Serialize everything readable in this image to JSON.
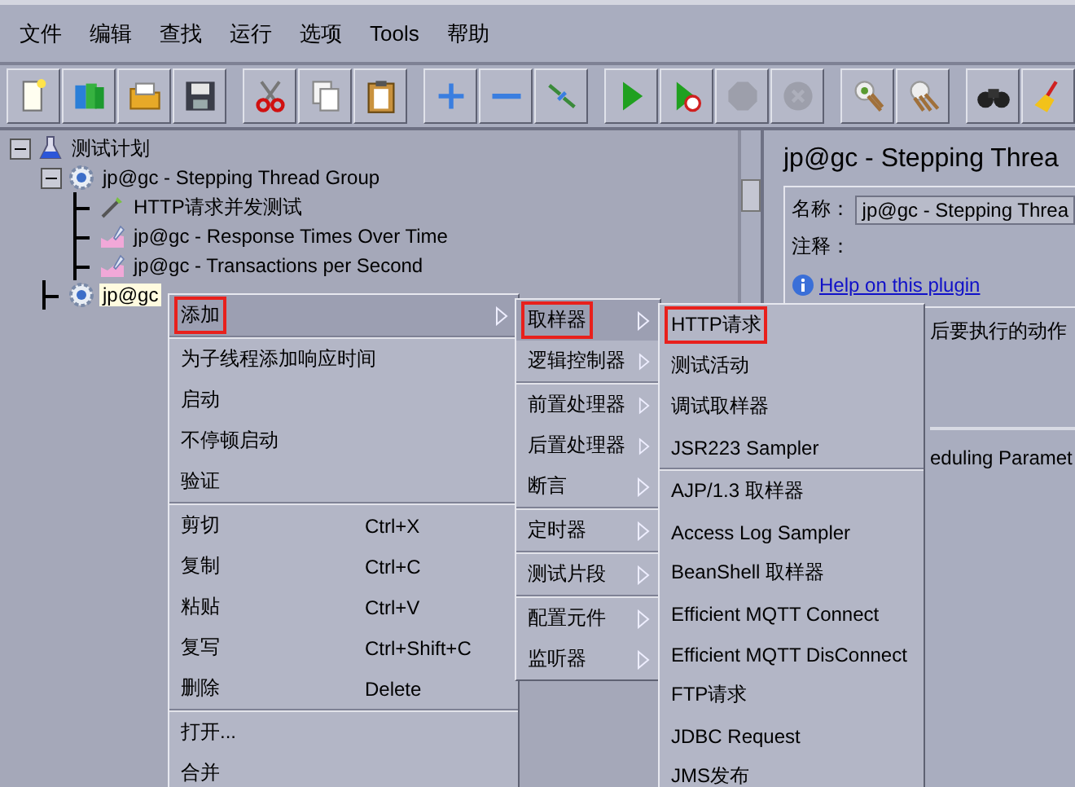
{
  "menu_bar": [
    {
      "label": "文件"
    },
    {
      "label": "编辑"
    },
    {
      "label": "查找"
    },
    {
      "label": "运行"
    },
    {
      "label": "选项"
    },
    {
      "label": "Tools"
    },
    {
      "label": "帮助"
    }
  ],
  "toolbar": [
    [
      {
        "kind": "new",
        "disabled": false
      },
      {
        "kind": "templates",
        "disabled": false
      },
      {
        "kind": "open",
        "disabled": false
      },
      {
        "kind": "save",
        "disabled": false
      }
    ],
    [
      {
        "kind": "cut",
        "disabled": false
      },
      {
        "kind": "copy",
        "disabled": false
      },
      {
        "kind": "paste",
        "disabled": false
      }
    ],
    [
      {
        "kind": "expand",
        "disabled": false
      },
      {
        "kind": "collapse",
        "disabled": false
      },
      {
        "kind": "toggle",
        "disabled": false
      }
    ],
    [
      {
        "kind": "start",
        "disabled": false
      },
      {
        "kind": "start_no_pause",
        "disabled": false
      },
      {
        "kind": "stop",
        "disabled": true
      },
      {
        "kind": "shutdown",
        "disabled": true
      }
    ],
    [
      {
        "kind": "clear",
        "disabled": false
      },
      {
        "kind": "clear_all",
        "disabled": false
      }
    ],
    [
      {
        "kind": "search",
        "disabled": false
      },
      {
        "kind": "reset_search",
        "disabled": false
      }
    ]
  ],
  "tree": [
    {
      "label": "测试计划",
      "kind": "plan",
      "expanded": true,
      "selected": false,
      "children": [
        {
          "label": "jp@gc - Stepping Thread Group",
          "kind": "thread_group",
          "expanded": true,
          "selected": false,
          "children": [
            {
              "label": "HTTP请求并发测试",
              "kind": "sampler",
              "selected": false
            },
            {
              "label": "jp@gc - Response Times Over Time",
              "kind": "listener",
              "selected": false
            },
            {
              "label": "jp@gc - Transactions per Second",
              "kind": "listener",
              "selected": false
            }
          ]
        },
        {
          "label": "jp@gc",
          "kind": "thread_group",
          "selected": true
        }
      ]
    }
  ],
  "details": {
    "title": "jp@gc - Stepping Threa",
    "name_label": "名称：",
    "name_value": "jp@gc - Stepping Threa",
    "comment_label": "注释：",
    "help_link": "Help on this plugin",
    "section_1": "后要执行的动作",
    "section_2": "eduling Paramet"
  },
  "context_menu": [
    [
      {
        "label": "添加",
        "has_submenu": true,
        "selected": true,
        "annotated": true
      }
    ],
    [
      {
        "label": "为子线程添加响应时间",
        "has_submenu": false,
        "selected": false,
        "annotated": false
      },
      {
        "label": "启动",
        "has_submenu": false,
        "selected": false,
        "annotated": false
      },
      {
        "label": "不停顿启动",
        "has_submenu": false,
        "selected": false,
        "annotated": false
      },
      {
        "label": "验证",
        "has_submenu": false,
        "selected": false,
        "annotated": false
      }
    ],
    [
      {
        "label": "剪切",
        "shortcut": "Ctrl+X",
        "has_submenu": false,
        "selected": false,
        "annotated": false
      },
      {
        "label": "复制",
        "shortcut": "Ctrl+C",
        "has_submenu": false,
        "selected": false,
        "annotated": false
      },
      {
        "label": "粘贴",
        "shortcut": "Ctrl+V",
        "has_submenu": false,
        "selected": false,
        "annotated": false
      },
      {
        "label": "复写",
        "shortcut": "Ctrl+Shift+C",
        "has_submenu": false,
        "selected": false,
        "annotated": false
      },
      {
        "label": "删除",
        "shortcut": "Delete",
        "has_submenu": false,
        "selected": false,
        "annotated": false
      }
    ],
    [
      {
        "label": "打开...",
        "has_submenu": false,
        "selected": false,
        "annotated": false
      },
      {
        "label": "合并",
        "has_submenu": false,
        "selected": false,
        "annotated": false
      }
    ]
  ],
  "add_submenu": [
    [
      {
        "label": "取样器",
        "has_submenu": true,
        "selected": true,
        "annotated": true
      },
      {
        "label": "逻辑控制器",
        "has_submenu": true,
        "selected": false,
        "annotated": false
      }
    ],
    [
      {
        "label": "前置处理器",
        "has_submenu": true,
        "selected": false,
        "annotated": false
      },
      {
        "label": "后置处理器",
        "has_submenu": true,
        "selected": false,
        "annotated": false
      },
      {
        "label": "断言",
        "has_submenu": true,
        "selected": false,
        "annotated": false
      }
    ],
    [
      {
        "label": "定时器",
        "has_submenu": true,
        "selected": false,
        "annotated": false
      }
    ],
    [
      {
        "label": "测试片段",
        "has_submenu": true,
        "selected": false,
        "annotated": false
      }
    ],
    [
      {
        "label": "配置元件",
        "has_submenu": true,
        "selected": false,
        "annotated": false
      },
      {
        "label": "监听器",
        "has_submenu": true,
        "selected": false,
        "annotated": false
      }
    ]
  ],
  "sampler_submenu": [
    [
      {
        "label": "HTTP请求",
        "selected": false,
        "annotated": true
      },
      {
        "label": "测试活动",
        "selected": false,
        "annotated": false
      },
      {
        "label": "调试取样器",
        "selected": false,
        "annotated": false
      },
      {
        "label": "JSR223 Sampler",
        "selected": false,
        "annotated": false
      }
    ],
    [
      {
        "label": "AJP/1.3 取样器",
        "selected": false,
        "annotated": false
      },
      {
        "label": "Access Log Sampler",
        "selected": false,
        "annotated": false
      },
      {
        "label": "BeanShell 取样器",
        "selected": false,
        "annotated": false
      },
      {
        "label": "Efficient MQTT Connect",
        "selected": false,
        "annotated": false
      },
      {
        "label": "Efficient MQTT DisConnect",
        "selected": false,
        "annotated": false
      },
      {
        "label": "FTP请求",
        "selected": false,
        "annotated": false
      },
      {
        "label": "JDBC Request",
        "selected": false,
        "annotated": false
      },
      {
        "label": "JMS发布",
        "selected": false,
        "annotated": false
      }
    ]
  ]
}
